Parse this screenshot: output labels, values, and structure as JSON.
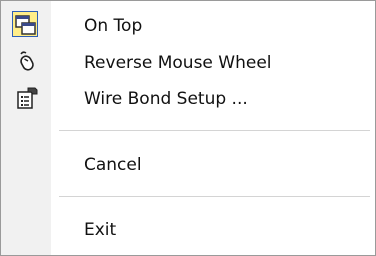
{
  "menu": {
    "items": [
      {
        "label": "On Top",
        "icon": "window-stack-icon",
        "checked": true
      },
      {
        "label": "Reverse Mouse Wheel",
        "icon": "mouse-icon"
      },
      {
        "label": "Wire Bond Setup ...",
        "icon": "wirebond-setup-icon"
      },
      {
        "label": "Cancel"
      },
      {
        "label": "Exit"
      }
    ]
  },
  "colors": {
    "checked_background": "#ffee8a",
    "checked_border": "#2e5fb6",
    "gutter": "#f1f1f1",
    "separator": "#d4d4d4"
  }
}
